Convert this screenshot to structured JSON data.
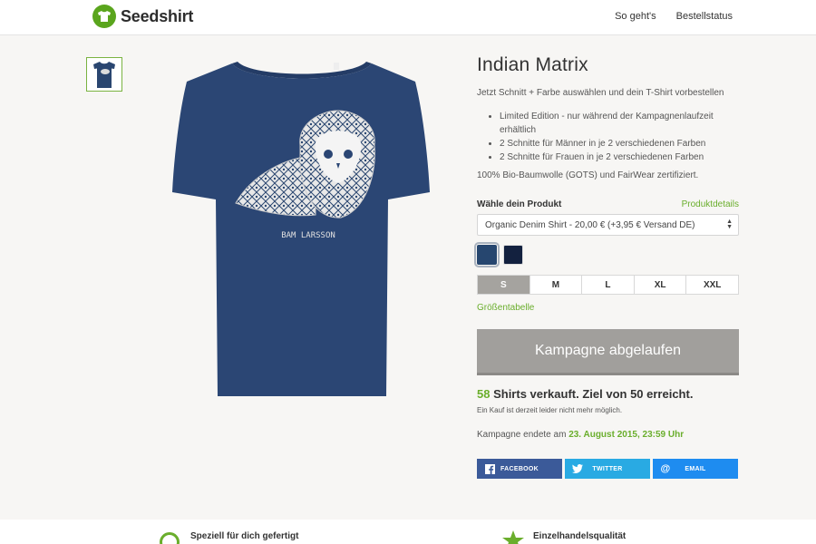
{
  "header": {
    "brand": "Seedshirt",
    "nav": [
      "So geht's",
      "Bestellstatus"
    ]
  },
  "product": {
    "title": "Indian Matrix",
    "subtitle": "Jetzt Schnitt + Farbe auswählen und dein T-Shirt vorbestellen",
    "bullets": [
      "Limited Edition - nur während der Kampagnenlaufzeit erhältlich",
      "2 Schnitte für Männer in je 2 verschiedenen Farben",
      "2 Schnitte für Frauen in je 2 verschiedenen Farben"
    ],
    "certification": "100% Bio-Baumwolle (GOTS) und FairWear zertifiziert.",
    "shirt_text": "BAM LARSSON"
  },
  "selector": {
    "label": "Wähle dein Produkt",
    "details_link": "Produktdetails",
    "selected": "Organic Denim Shirt - 20,00 € (+3,95 € Versand DE)",
    "colors": [
      "#26466f",
      "#13213f"
    ],
    "sizes": [
      "S",
      "M",
      "L",
      "XL",
      "XXL"
    ],
    "selected_size": "S",
    "size_table_link": "Größentabelle"
  },
  "campaign": {
    "button": "Kampagne abgelaufen",
    "sold_count": "58",
    "sold_text": " Shirts verkauft. Ziel von 50 erreicht.",
    "note": "Ein Kauf ist derzeit leider nicht mehr möglich.",
    "ended_prefix": "Kampagne endete am ",
    "ended_date": "23. August 2015, 23:59 Uhr"
  },
  "share": {
    "facebook": "FACEBOOK",
    "twitter": "TWITTER",
    "email": "EMAIL"
  },
  "features": [
    "Speziell für dich gefertigt",
    "Einzelhandelsqualität"
  ]
}
